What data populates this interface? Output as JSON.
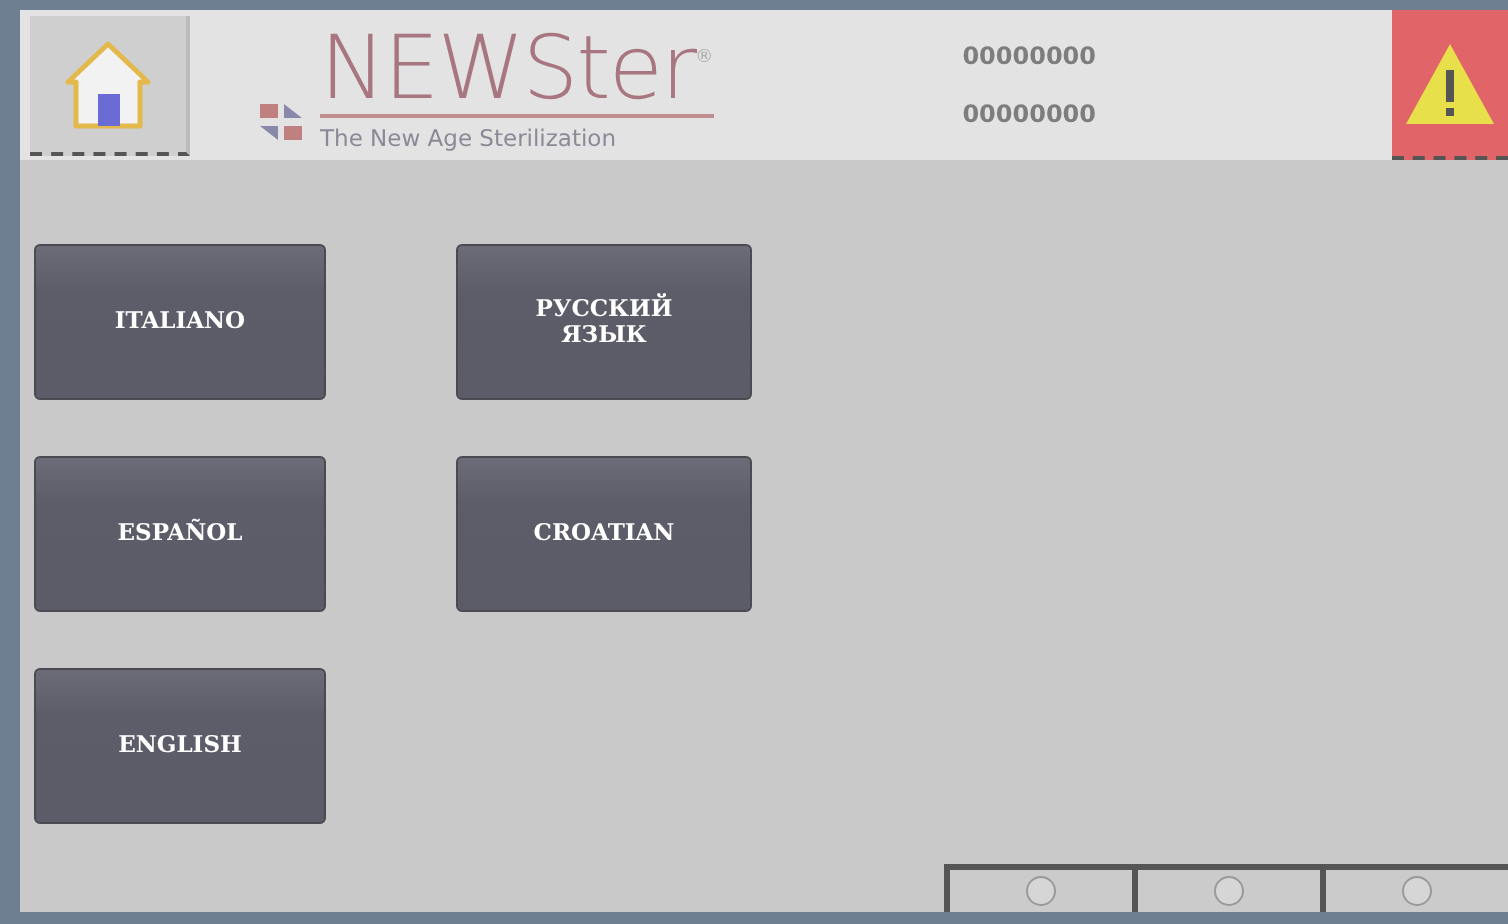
{
  "header": {
    "logo": {
      "name": "NEWSter",
      "registered": "®",
      "tagline": "The New Age Sterilization"
    },
    "counters": [
      "00000000",
      "00000000"
    ]
  },
  "languages": [
    {
      "label": "ITALIANO"
    },
    {
      "label": "ESPAÑOL"
    },
    {
      "label": "ENGLISH"
    },
    {
      "label": "РУССКИЙ ЯЗЫК"
    },
    {
      "label": "CROATIAN"
    }
  ],
  "indicators": [
    {
      "on": false
    },
    {
      "on": false
    },
    {
      "on": false
    }
  ]
}
